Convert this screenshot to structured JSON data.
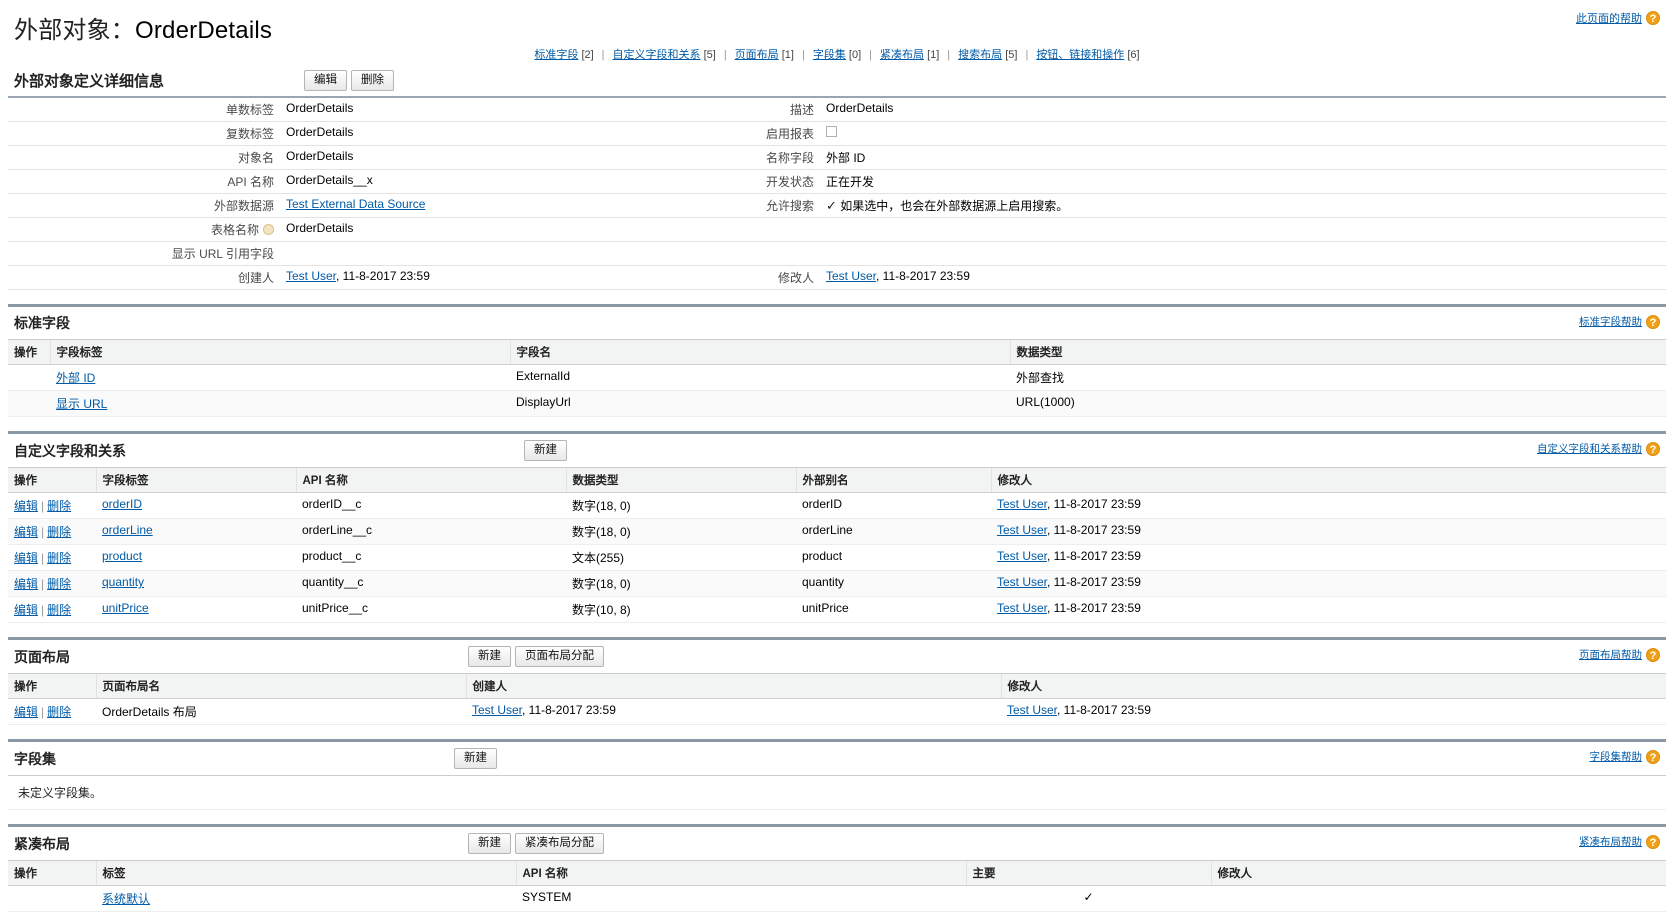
{
  "header": {
    "title_prefix": "外部对象：",
    "object_name": "OrderDetails",
    "help_link": "此页面的帮助",
    "help_icon": "question-mark-icon"
  },
  "quick_links": [
    {
      "label": "标准字段",
      "count": "[2]"
    },
    {
      "label": "自定义字段和关系",
      "count": "[5]"
    },
    {
      "label": "页面布局",
      "count": "[1]"
    },
    {
      "label": "字段集",
      "count": "[0]"
    },
    {
      "label": "紧凑布局",
      "count": "[1]"
    },
    {
      "label": "搜索布局",
      "count": "[5]"
    },
    {
      "label": "按钮、链接和操作",
      "count": "[6]"
    }
  ],
  "detail": {
    "title": "外部对象定义详细信息",
    "buttons": [
      "编辑",
      "删除"
    ],
    "left_rows": [
      {
        "label": "单数标签",
        "value": "OrderDetails",
        "type": "text"
      },
      {
        "label": "复数标签",
        "value": "OrderDetails",
        "type": "text"
      },
      {
        "label": "对象名",
        "value": "OrderDetails",
        "type": "text"
      },
      {
        "label": "API 名称",
        "value": "OrderDetails__x",
        "type": "text"
      },
      {
        "label": "外部数据源",
        "value": "Test External Data Source",
        "type": "link"
      },
      {
        "label": "表格名称",
        "value": "OrderDetails",
        "type": "text-info"
      },
      {
        "label": "显示 URL 引用字段",
        "value": "",
        "type": "text"
      },
      {
        "label": "创建人",
        "value": "Test User",
        "suffix": ", 11-8-2017 23:59",
        "type": "link-suffix"
      }
    ],
    "right_rows": [
      {
        "label": "描述",
        "value": "OrderDetails",
        "type": "text"
      },
      {
        "label": "启用报表",
        "value": "",
        "type": "checkbox-unchecked"
      },
      {
        "label": "名称字段",
        "value": "外部 ID",
        "type": "text"
      },
      {
        "label": "开发状态",
        "value": "正在开发",
        "type": "text"
      },
      {
        "label": "允许搜索",
        "value": "如果选中，也会在外部数据源上启用搜索。",
        "type": "checkmark-text"
      },
      {
        "label": "",
        "value": "",
        "type": "blank"
      },
      {
        "label": "",
        "value": "",
        "type": "blank"
      },
      {
        "label": "修改人",
        "value": "Test User",
        "suffix": ", 11-8-2017 23:59",
        "type": "link-suffix"
      }
    ]
  },
  "standard_fields": {
    "title": "标准字段",
    "help": "标准字段帮助",
    "columns": [
      "操作",
      "字段标签",
      "字段名",
      "数据类型"
    ],
    "rows": [
      {
        "action": "",
        "label": "外部 ID",
        "field_name": "ExternalId",
        "data_type": "外部查找"
      },
      {
        "action": "",
        "label": "显示 URL",
        "field_name": "DisplayUrl",
        "data_type": "URL(1000)"
      }
    ]
  },
  "custom_fields": {
    "title": "自定义字段和关系",
    "help": "自定义字段和关系帮助",
    "buttons": [
      "新建"
    ],
    "columns": [
      "操作",
      "字段标签",
      "API 名称",
      "数据类型",
      "外部别名",
      "修改人"
    ],
    "action_edit": "编辑",
    "action_delete": "删除",
    "rows": [
      {
        "label": "orderID",
        "api": "orderID__c",
        "type": "数字(18, 0)",
        "alias": "orderID",
        "modified_by": "Test User",
        "modified_at": ", 11-8-2017 23:59"
      },
      {
        "label": "orderLine",
        "api": "orderLine__c",
        "type": "数字(18, 0)",
        "alias": "orderLine",
        "modified_by": "Test User",
        "modified_at": ", 11-8-2017 23:59"
      },
      {
        "label": "product",
        "api": "product__c",
        "type": "文本(255)",
        "alias": "product",
        "modified_by": "Test User",
        "modified_at": ", 11-8-2017 23:59"
      },
      {
        "label": "quantity",
        "api": "quantity__c",
        "type": "数字(18, 0)",
        "alias": "quantity",
        "modified_by": "Test User",
        "modified_at": ", 11-8-2017 23:59"
      },
      {
        "label": "unitPrice",
        "api": "unitPrice__c",
        "type": "数字(10, 8)",
        "alias": "unitPrice",
        "modified_by": "Test User",
        "modified_at": ", 11-8-2017 23:59"
      }
    ]
  },
  "page_layouts": {
    "title": "页面布局",
    "help": "页面布局帮助",
    "buttons": [
      "新建",
      "页面布局分配"
    ],
    "columns": [
      "操作",
      "页面布局名",
      "创建人",
      "修改人"
    ],
    "action_edit": "编辑",
    "action_delete": "删除",
    "rows": [
      {
        "name": "OrderDetails 布局",
        "created_by": "Test User",
        "created_at": ", 11-8-2017 23:59",
        "modified_by": "Test User",
        "modified_at": ", 11-8-2017 23:59"
      }
    ]
  },
  "field_sets": {
    "title": "字段集",
    "help": "字段集帮助",
    "buttons": [
      "新建"
    ],
    "empty_text": "未定义字段集。"
  },
  "compact_layouts": {
    "title": "紧凑布局",
    "help": "紧凑布局帮助",
    "buttons": [
      "新建",
      "紧凑布局分配"
    ],
    "columns": [
      "操作",
      "标签",
      "API 名称",
      "主要",
      "修改人"
    ],
    "rows": [
      {
        "action": "",
        "label": "系统默认",
        "api": "SYSTEM",
        "primary": "✓",
        "modified_by": ""
      }
    ]
  },
  "colors": {
    "link": "#015ba7",
    "rule": "#8a97a5",
    "header_bg": "#f2f3f3",
    "help_icon": "#f0a017"
  }
}
